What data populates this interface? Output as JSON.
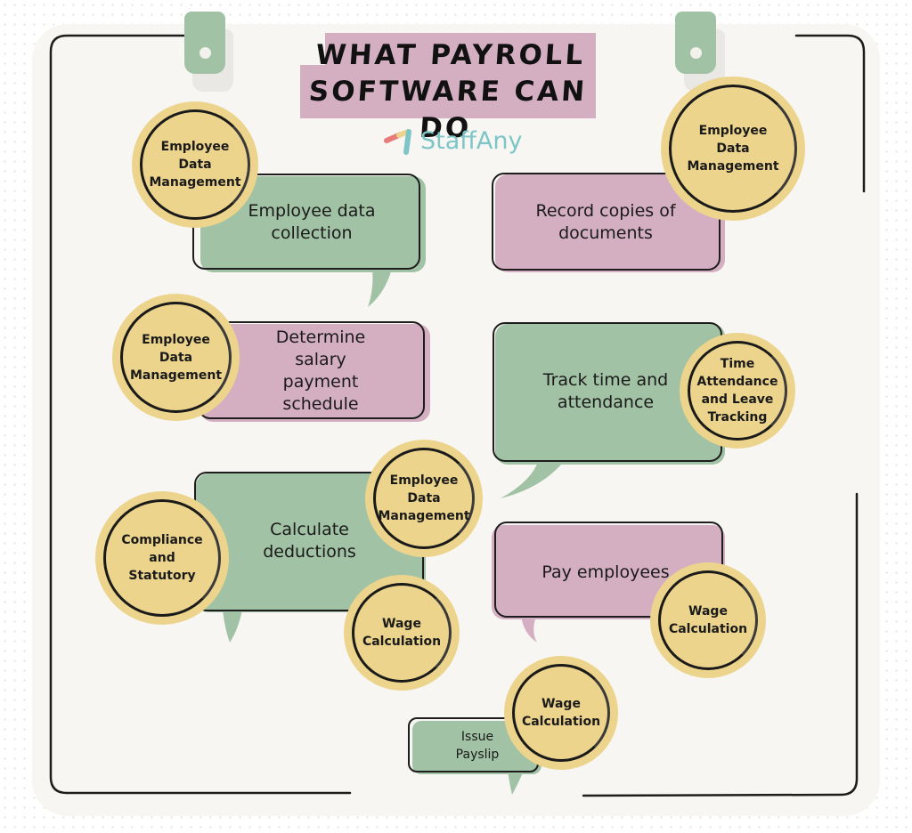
{
  "title": {
    "line1": "What Payroll",
    "line2": "Software Can Do"
  },
  "brand": {
    "name": "StaffAny",
    "icon": "staffany-logo-icon",
    "color": "#7ec5c7"
  },
  "colors": {
    "green_bubble": "#a1c2a4",
    "pink_bubble": "#d4afc1",
    "coin": "#ecd48c",
    "paper": "#f7f6f2",
    "outline": "#1d1d1d"
  },
  "functions": [
    {
      "label": "Employee data collection",
      "color": "green",
      "tags": [
        "Employee Data Management"
      ]
    },
    {
      "label": "Record copies of documents",
      "color": "pink",
      "tags": [
        "Employee Data Management"
      ]
    },
    {
      "label": "Determine salary payment schedule",
      "color": "pink",
      "tags": [
        "Employee Data Management"
      ]
    },
    {
      "label": "Track time and attendance",
      "color": "green",
      "tags": [
        "Time Attendance and Leave Tracking"
      ]
    },
    {
      "label": "Calculate deductions",
      "color": "green",
      "tags": [
        "Compliance and Statutory",
        "Employee Data Management",
        "Wage Calculation"
      ]
    },
    {
      "label": "Pay employees",
      "color": "pink",
      "tags": [
        "Wage Calculation"
      ]
    },
    {
      "label": "Issue Payslip",
      "color": "green",
      "tags": [
        "Wage Calculation"
      ]
    }
  ],
  "coins": {
    "c1": "Employee\nData\nManagement",
    "c2": "Employee\nData\nManagement",
    "c3": "Employee\nData\nManagement",
    "c4": "Time\nAttendance\nand Leave\nTracking",
    "c5": "Compliance\nand\nStatutory",
    "c6": "Employee\nData\nManagement",
    "c7": "Wage\nCalculation",
    "c8": "Wage\nCalculation",
    "c9": "Wage\nCalculation"
  },
  "bubbles": {
    "b1": "Employee data\ncollection",
    "b2": "Record copies of\ndocuments",
    "b3": "Determine\nsalary\npayment\nschedule",
    "b4": "Track time and\nattendance",
    "b5": "Calculate\ndeductions",
    "b6": "Pay employees",
    "b7": "Issue\nPayslip"
  }
}
